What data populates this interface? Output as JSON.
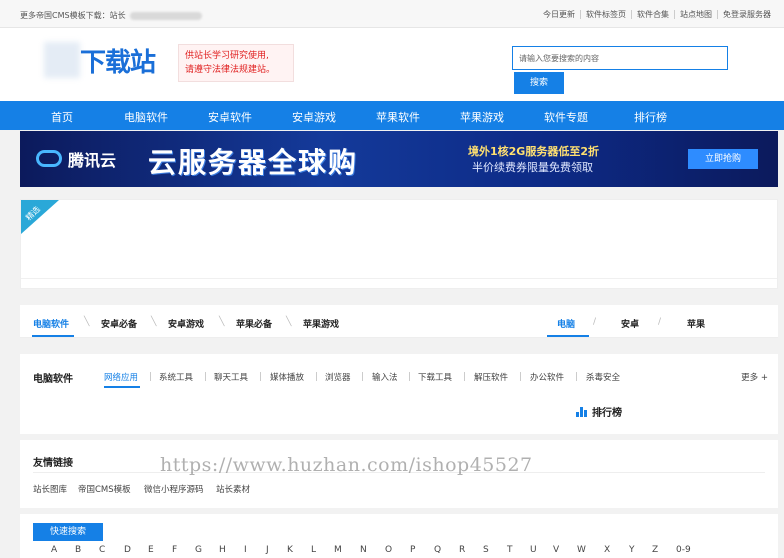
{
  "topbar": {
    "text": "更多帝国CMS模板下载：站长",
    "links": [
      "今日更新",
      "软件标签页",
      "软件合集",
      "站点地图",
      "免登录服务器"
    ]
  },
  "header": {
    "logo": "下载站",
    "notice_line1": "供站长学习研究使用,",
    "notice_line2": "请遵守法律法规建站。",
    "search_placeholder": "请输入您要搜索的内容",
    "search_button": "搜索"
  },
  "nav": [
    "首页",
    "电脑软件",
    "安卓软件",
    "安卓游戏",
    "苹果软件",
    "苹果游戏",
    "软件专题",
    "排行榜"
  ],
  "banner": {
    "brand": "腾讯云",
    "headline": "云服务器全球购",
    "line1": "境外1核2G服务器低至2折",
    "line2": "半价续费券限量免费领取",
    "cta": "立即抢购"
  },
  "featured": {
    "badge": "精选"
  },
  "tabrow": {
    "tabs": [
      "电脑软件",
      "安卓必备",
      "安卓游戏",
      "苹果必备",
      "苹果游戏"
    ],
    "platforms": [
      "电脑",
      "安卓",
      "苹果"
    ]
  },
  "category": {
    "title": "电脑软件",
    "items": [
      "网络应用",
      "系统工具",
      "聊天工具",
      "媒体播放",
      "浏览器",
      "输入法",
      "下载工具",
      "解压软件",
      "办公软件",
      "杀毒安全"
    ],
    "more": "更多 +",
    "rank": "排行榜"
  },
  "links": {
    "title": "友情链接",
    "items": [
      "站长图库",
      "帝国CMS模板",
      "微信小程序源码",
      "站长素材"
    ]
  },
  "watermark": "https://www.huzhan.com/ishop45527",
  "quick": {
    "button": "快速搜索",
    "letters": [
      "A",
      "B",
      "C",
      "D",
      "E",
      "F",
      "G",
      "H",
      "I",
      "J",
      "K",
      "L",
      "M",
      "N",
      "O",
      "P",
      "Q",
      "R",
      "S",
      "T",
      "U",
      "V",
      "W",
      "X",
      "Y",
      "Z",
      "0-9"
    ]
  }
}
